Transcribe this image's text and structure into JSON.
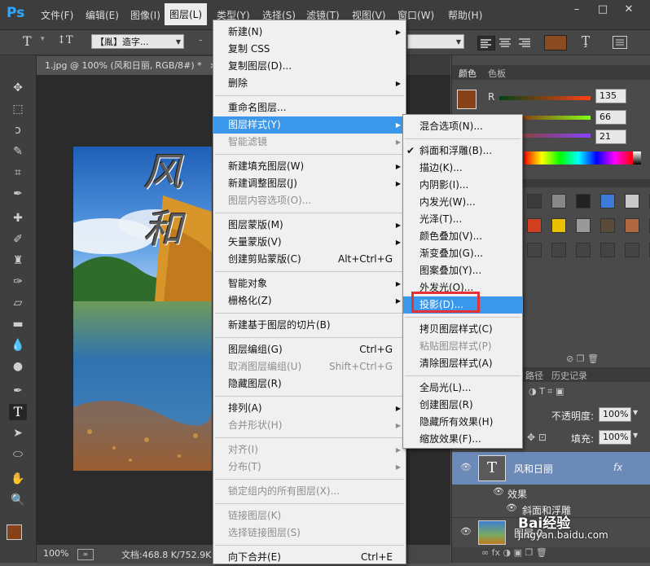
{
  "app": {
    "logo": "Ps"
  },
  "menubar": {
    "items": [
      "文件(F)",
      "编辑(E)",
      "图像(I)",
      "图层(L)",
      "类型(Y)",
      "选择(S)",
      "滤镜(T)",
      "视图(V)",
      "窗口(W)",
      "帮助(H)"
    ],
    "active_index": 3,
    "window_buttons": [
      "–",
      "□",
      "✕"
    ]
  },
  "options": {
    "tool_glyph": "T",
    "orient_glyph": "↕T",
    "font_family": "【胤】造字...",
    "font_size_sep": "-",
    "icon_names": [
      "text-tool-icon",
      "text-orientation-icon",
      "align-left-icon",
      "align-center-icon",
      "align-right-icon",
      "text-color-swatch",
      "warp-text-icon",
      "character-panel-icon"
    ],
    "color": "#8a4a22"
  },
  "document": {
    "tab_title": "1.jpg @ 100% (风和日丽, RGB/8#) *",
    "tab_close": "×",
    "photo_text": "风和"
  },
  "status": {
    "zoom": "100%",
    "doc_info": "文档:468.8 K/752.9K"
  },
  "panels": {
    "color_tabs": [
      "颜色",
      "色板"
    ],
    "rgb": [
      {
        "label": "R",
        "value": "135"
      },
      {
        "label": "G",
        "value": "66"
      },
      {
        "label": "B",
        "value": "21"
      }
    ],
    "history_tabs": [
      "路径",
      "历史记录"
    ],
    "opacity_label": "不透明度:",
    "opacity_value": "100%",
    "fill_label": "填充:",
    "fill_value": "100%",
    "layers": [
      {
        "name": "风和日丽",
        "fx": "fx",
        "type": "text"
      },
      {
        "name": "效果",
        "type": "effects"
      },
      {
        "name": "斜面和浮雕",
        "type": "effect"
      },
      {
        "name": "图层 0",
        "type": "image"
      }
    ]
  },
  "layer_menu": {
    "items": [
      {
        "label": "新建(N)",
        "sub": true
      },
      {
        "label": "复制 CSS"
      },
      {
        "label": "复制图层(D)..."
      },
      {
        "label": "删除",
        "sub": true
      },
      {
        "sep": true
      },
      {
        "label": "重命名图层..."
      },
      {
        "label": "图层样式(Y)",
        "sub": true,
        "hl": true
      },
      {
        "label": "智能滤镜",
        "sub": true,
        "dis": true
      },
      {
        "sep": true
      },
      {
        "label": "新建填充图层(W)",
        "sub": true
      },
      {
        "label": "新建调整图层(J)",
        "sub": true
      },
      {
        "label": "图层内容选项(O)...",
        "dis": true
      },
      {
        "sep": true
      },
      {
        "label": "图层蒙版(M)",
        "sub": true
      },
      {
        "label": "矢量蒙版(V)",
        "sub": true
      },
      {
        "label": "创建剪贴蒙版(C)",
        "shortcut": "Alt+Ctrl+G"
      },
      {
        "sep": true
      },
      {
        "label": "智能对象",
        "sub": true
      },
      {
        "label": "栅格化(Z)",
        "sub": true
      },
      {
        "sep": true
      },
      {
        "label": "新建基于图层的切片(B)"
      },
      {
        "sep": true
      },
      {
        "label": "图层编组(G)",
        "shortcut": "Ctrl+G"
      },
      {
        "label": "取消图层编组(U)",
        "shortcut": "Shift+Ctrl+G",
        "dis": true
      },
      {
        "label": "隐藏图层(R)"
      },
      {
        "sep": true
      },
      {
        "label": "排列(A)",
        "sub": true
      },
      {
        "label": "合并形状(H)",
        "sub": true,
        "dis": true
      },
      {
        "sep": true
      },
      {
        "label": "对齐(I)",
        "sub": true,
        "dis": true
      },
      {
        "label": "分布(T)",
        "sub": true,
        "dis": true
      },
      {
        "sep": true
      },
      {
        "label": "锁定组内的所有图层(X)...",
        "dis": true
      },
      {
        "sep": true
      },
      {
        "label": "链接图层(K)",
        "dis": true
      },
      {
        "label": "选择链接图层(S)",
        "dis": true
      },
      {
        "sep": true
      },
      {
        "label": "向下合并(E)",
        "shortcut": "Ctrl+E"
      }
    ]
  },
  "style_menu": {
    "items": [
      {
        "label": "混合选项(N)..."
      },
      {
        "sep": true
      },
      {
        "label": "斜面和浮雕(B)...",
        "checked": true
      },
      {
        "label": "描边(K)..."
      },
      {
        "label": "内阴影(I)..."
      },
      {
        "label": "内发光(W)..."
      },
      {
        "label": "光泽(T)..."
      },
      {
        "label": "颜色叠加(V)..."
      },
      {
        "label": "渐变叠加(G)..."
      },
      {
        "label": "图案叠加(Y)..."
      },
      {
        "label": "外发光(O)..."
      },
      {
        "label": "投影(D)...",
        "hl": true
      },
      {
        "sep": true
      },
      {
        "label": "拷贝图层样式(C)"
      },
      {
        "label": "粘贴图层样式(P)",
        "dis": true
      },
      {
        "label": "清除图层样式(A)"
      },
      {
        "sep": true
      },
      {
        "label": "全局光(L)..."
      },
      {
        "label": "创建图层(R)"
      },
      {
        "label": "隐藏所有效果(H)"
      },
      {
        "label": "缩放效果(F)..."
      }
    ]
  },
  "watermark": {
    "text": "Bai经验",
    "url": "jingyan.baidu.com"
  }
}
